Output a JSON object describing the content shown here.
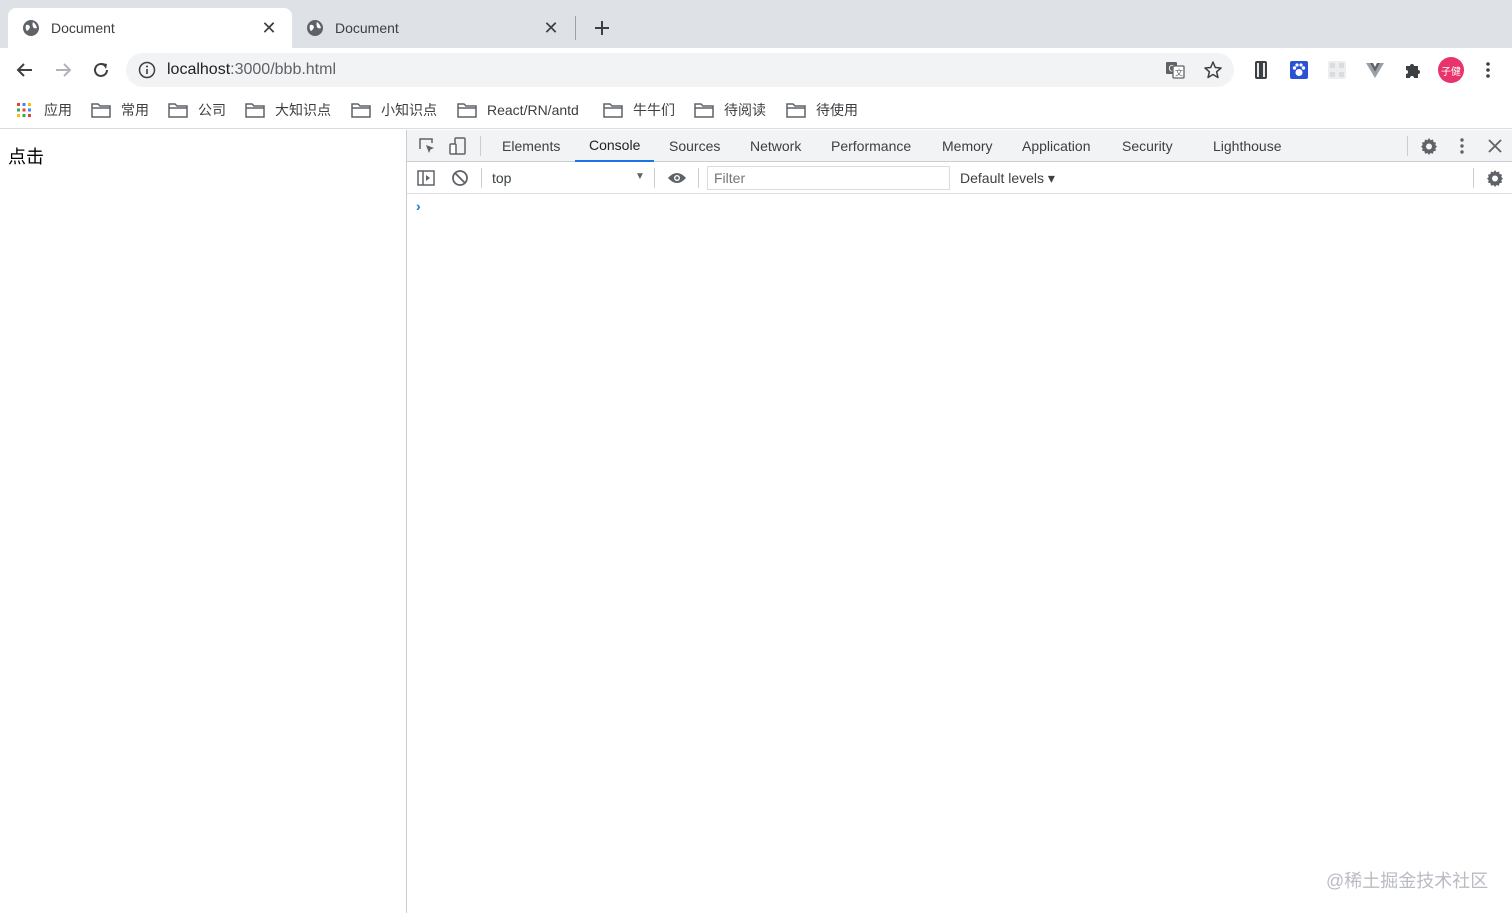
{
  "tabs": [
    {
      "title": "Document",
      "active": true
    },
    {
      "title": "Document",
      "active": false
    }
  ],
  "toolbar": {
    "url_host": "localhost",
    "url_path": ":3000/bbb.html",
    "avatar_text": "子健"
  },
  "bookmarks": [
    {
      "label": "应用",
      "icon": "apps-grid-icon"
    },
    {
      "label": "常用",
      "icon": "folder-icon"
    },
    {
      "label": "公司",
      "icon": "folder-icon"
    },
    {
      "label": "大知识点",
      "icon": "folder-icon"
    },
    {
      "label": "小知识点",
      "icon": "folder-icon"
    },
    {
      "label": "React/RN/antd",
      "icon": "folder-icon"
    },
    {
      "label": "牛牛们",
      "icon": "folder-icon"
    },
    {
      "label": "待阅读",
      "icon": "folder-icon"
    },
    {
      "label": "待使用",
      "icon": "folder-icon"
    }
  ],
  "page": {
    "content_text": "点击"
  },
  "devtools": {
    "tabs": [
      "Elements",
      "Console",
      "Sources",
      "Network",
      "Performance",
      "Memory",
      "Application",
      "Security",
      "Lighthouse"
    ],
    "active_tab": "Console",
    "console": {
      "context": "top",
      "filter_placeholder": "Filter",
      "levels_label": "Default levels ▾",
      "prompt": "›"
    }
  },
  "watermark": "@稀土掘金技术社区",
  "colors": {
    "tabstrip_bg": "#dee1e6",
    "accent": "#1a73e8",
    "avatar_bg": "#e8336b"
  }
}
